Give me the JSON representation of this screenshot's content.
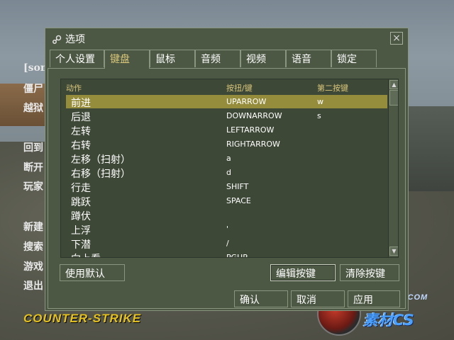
{
  "background": {
    "menu_items": [
      "[son",
      "僵尸",
      "越狱",
      "回到",
      "断开",
      "玩家",
      "新建",
      "搜索",
      "游戏",
      "退出"
    ],
    "logo_text": "COUNTER-STRIKE",
    "watermark_site": "CSPORPACK.COM",
    "watermark_brand": "素材CS"
  },
  "dialog": {
    "title": "选项",
    "close_label": "×",
    "tabs": [
      {
        "label": "个人设置"
      },
      {
        "label": "键盘"
      },
      {
        "label": "鼠标"
      },
      {
        "label": "音频"
      },
      {
        "label": "视频"
      },
      {
        "label": "语音"
      },
      {
        "label": "锁定"
      }
    ],
    "active_tab": "键盘",
    "keyboard": {
      "headers": {
        "action": "动作",
        "key": "按扭/键",
        "alt": "第二按键"
      },
      "rows": [
        {
          "action": "前进",
          "key": "UPARROW",
          "alt": "w"
        },
        {
          "action": "后退",
          "key": "DOWNARROW",
          "alt": "s"
        },
        {
          "action": "左转",
          "key": "LEFTARROW",
          "alt": ""
        },
        {
          "action": "右转",
          "key": "RIGHTARROW",
          "alt": ""
        },
        {
          "action": "左移（扫射）",
          "key": "a",
          "alt": ""
        },
        {
          "action": "右移（扫射）",
          "key": "d",
          "alt": ""
        },
        {
          "action": "行走",
          "key": "SHIFT",
          "alt": ""
        },
        {
          "action": "跳跃",
          "key": "SPACE",
          "alt": ""
        },
        {
          "action": "蹲伏",
          "key": "",
          "alt": ""
        },
        {
          "action": "上浮",
          "key": "'",
          "alt": ""
        },
        {
          "action": "下潜",
          "key": "/",
          "alt": ""
        },
        {
          "action": "向上看",
          "key": "PGUP",
          "alt": ""
        }
      ],
      "selected_row": 0,
      "use_defaults_label": "使用默认",
      "edit_key_label": "编辑按键",
      "clear_key_label": "清除按键"
    },
    "ok_label": "确认",
    "cancel_label": "取消",
    "apply_label": "应用"
  },
  "colors": {
    "dialog_bg": "#4c5844",
    "list_bg": "#3e4837",
    "selection": "#958d3c",
    "header_text": "#d9c67a",
    "logo": "#e6c21e"
  }
}
